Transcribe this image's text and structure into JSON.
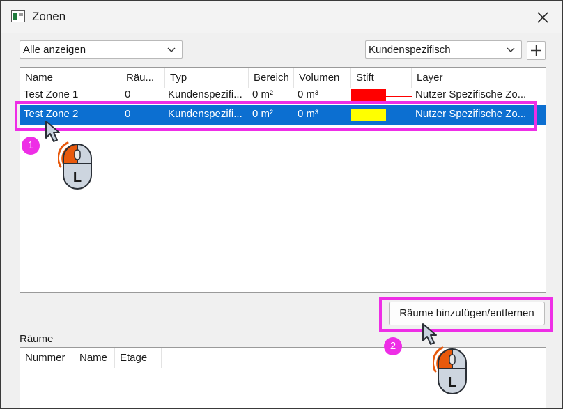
{
  "window": {
    "title": "Zonen"
  },
  "filter": {
    "selected": "Alle anzeigen"
  },
  "zone_type": {
    "selected": "Kundenspezifisch"
  },
  "zones_table": {
    "columns": [
      "Name",
      "Räu...",
      "Typ",
      "Bereich",
      "Volumen",
      "Stift",
      "Layer"
    ],
    "rows": [
      {
        "name": "Test Zone 1",
        "rooms": "0",
        "type": "Kundenspezifi...",
        "area": "0 m²",
        "volume": "0 m³",
        "pen_color": "#ff0000",
        "layer": "Nutzer Spezifische Zo..."
      },
      {
        "name": "Test Zone 2",
        "rooms": "0",
        "type": "Kundenspezifi...",
        "area": "0 m²",
        "volume": "0 m³",
        "pen_color": "#ffff00",
        "layer": "Nutzer Spezifische Zo...",
        "selected": true
      }
    ]
  },
  "rooms_button": {
    "label": "Räume hinzufügen/entfernen"
  },
  "rooms_section": {
    "label": "Räume",
    "columns": [
      "Nummer",
      "Name",
      "Etage"
    ]
  },
  "annotations": {
    "steps": [
      "1",
      "2"
    ],
    "mouse_button": "L",
    "highlight_color": "#ee2ee6"
  },
  "colors": {
    "selection": "#0c6fd1",
    "accent_mouse": "#e8590c"
  }
}
